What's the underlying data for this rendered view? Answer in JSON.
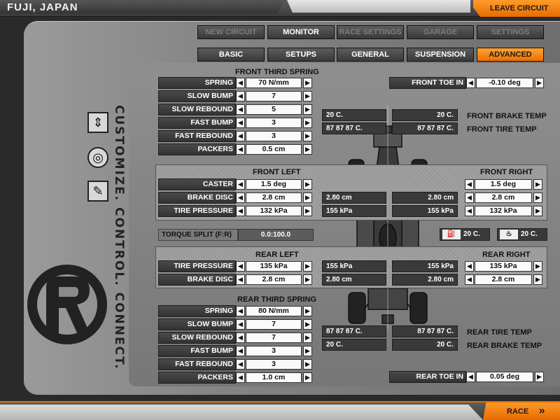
{
  "header": {
    "track": "FUJI, JAPAN",
    "leave": "LEAVE CIRCUIT"
  },
  "top_tabs": [
    "NEW CIRCUIT",
    "MONITOR",
    "RACE SETTINGS",
    "GARAGE",
    "SETTINGS"
  ],
  "sub_tabs": [
    "BASIC",
    "SETUPS",
    "GENERAL",
    "SUSPENSION",
    "ADVANCED"
  ],
  "slogan": "CUSTOMIZE. CONTROL. CONNECT.",
  "front_third": {
    "title": "FRONT THIRD SPRING",
    "rows": [
      {
        "label": "SPRING",
        "value": "70 N/mm"
      },
      {
        "label": "SLOW BUMP",
        "value": "7"
      },
      {
        "label": "SLOW REBOUND",
        "value": "5"
      },
      {
        "label": "FAST BUMP",
        "value": "3"
      },
      {
        "label": "FAST REBOUND",
        "value": "3"
      },
      {
        "label": "PACKERS",
        "value": "0.5 cm"
      }
    ]
  },
  "front_toe": {
    "label": "FRONT TOE IN",
    "value": "-0.10 deg"
  },
  "front_temps": {
    "brake_left": "20 C.",
    "brake_right": "20 C.",
    "brake_label": "FRONT BRAKE TEMP",
    "tire_left": "87  87  87 C.",
    "tire_right": "87  87  87 C.",
    "tire_label": "FRONT TIRE TEMP"
  },
  "front_left": {
    "title": "FRONT LEFT",
    "caster": {
      "label": "CASTER",
      "value": "1.5 deg"
    },
    "brake": {
      "label": "BRAKE DISC",
      "value": "2.8 cm",
      "readout": "2.80 cm"
    },
    "pressure": {
      "label": "TIRE PRESSURE",
      "value": "132 kPa",
      "readout": "155 kPa"
    }
  },
  "front_right": {
    "title": "FRONT RIGHT",
    "caster": "1.5 deg",
    "brake": {
      "value": "2.8 cm",
      "readout": "2.80 cm"
    },
    "pressure": {
      "value": "132 kPa",
      "readout": "155 kPa"
    }
  },
  "torque": {
    "label": "TORQUE SPLIT (F:R)",
    "value": "0.0:100.0"
  },
  "engine": {
    "oil": "20 C.",
    "water": "20 C."
  },
  "rear_left": {
    "title": "REAR LEFT",
    "pressure": {
      "label": "TIRE PRESSURE",
      "value": "135 kPa",
      "readout": "155 kPa"
    },
    "brake": {
      "label": "BRAKE DISC",
      "value": "2.8 cm",
      "readout": "2.80 cm"
    }
  },
  "rear_right": {
    "title": "REAR RIGHT",
    "pressure": {
      "value": "135 kPa",
      "readout": "155 kPa"
    },
    "brake": {
      "value": "2.8 cm",
      "readout": "2.80 cm"
    }
  },
  "rear_third": {
    "title": "REAR THIRD SPRING",
    "rows": [
      {
        "label": "SPRING",
        "value": "80 N/mm"
      },
      {
        "label": "SLOW BUMP",
        "value": "7"
      },
      {
        "label": "SLOW REBOUND",
        "value": "7"
      },
      {
        "label": "FAST BUMP",
        "value": "3"
      },
      {
        "label": "FAST REBOUND",
        "value": "3"
      },
      {
        "label": "PACKERS",
        "value": "1.0 cm"
      }
    ]
  },
  "rear_temps": {
    "tire_left": "87  87  87 C.",
    "tire_right": "87  87  87 C.",
    "tire_label": "REAR TIRE TEMP",
    "brake_left": "20 C.",
    "brake_right": "20 C.",
    "brake_label": "REAR BRAKE TEMP"
  },
  "rear_toe": {
    "label": "REAR TOE IN",
    "value": "0.05 deg"
  },
  "footer": {
    "race": "RACE"
  },
  "arrows": {
    "left": "◀",
    "right": "▶"
  }
}
